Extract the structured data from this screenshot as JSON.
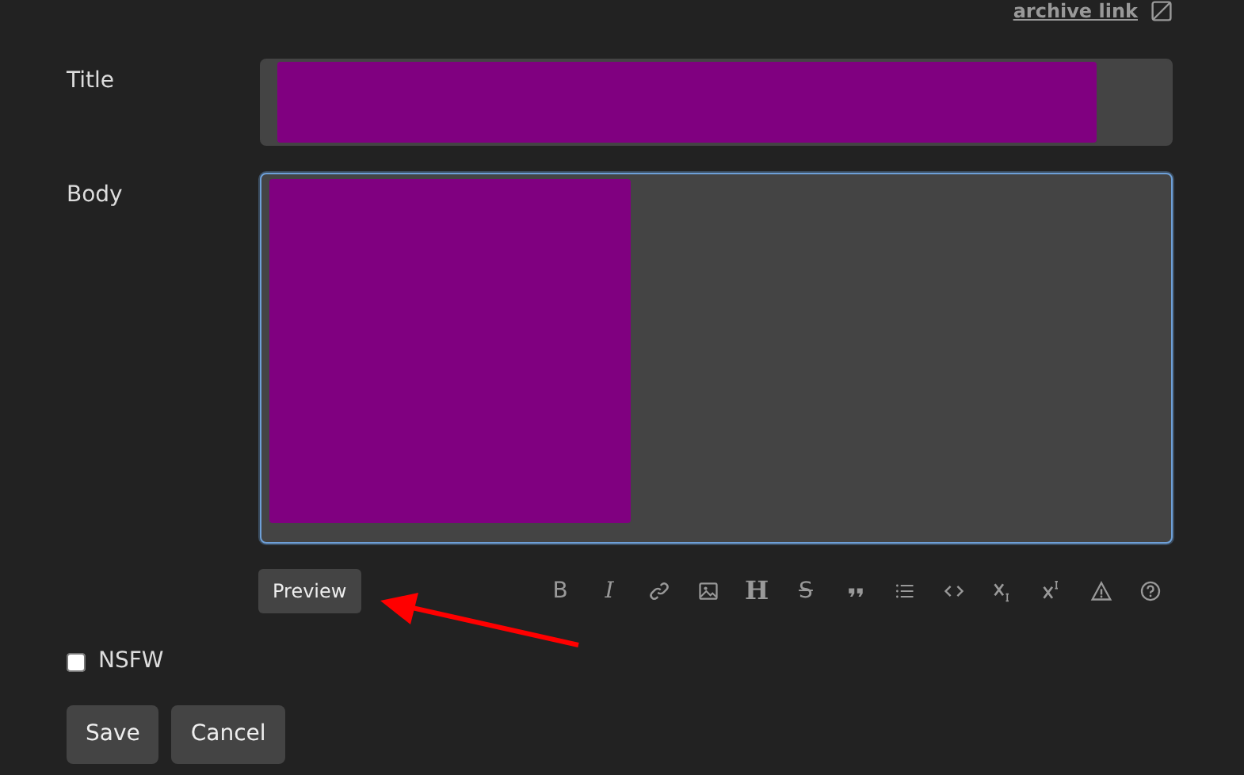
{
  "archive_link": {
    "label": "archive link"
  },
  "title_field": {
    "label": "Title",
    "redacted": true
  },
  "body_field": {
    "label": "Body",
    "redacted": true,
    "focused": true
  },
  "preview_button": "Preview",
  "toolbar": [
    {
      "kind": "glyph",
      "text": "B"
    },
    {
      "kind": "glyph",
      "text": "I"
    },
    {
      "kind": "icon"
    },
    {
      "kind": "icon"
    },
    {
      "kind": "glyph",
      "text": "H"
    },
    {
      "kind": "glyph",
      "text": "S"
    },
    {
      "kind": "icon"
    },
    {
      "kind": "icon"
    },
    {
      "kind": "icon"
    },
    {
      "kind": "icon"
    },
    {
      "kind": "icon"
    },
    {
      "kind": "icon"
    },
    {
      "kind": "icon"
    }
  ],
  "nsfw": {
    "label": "NSFW",
    "checked": false
  },
  "buttons": [
    "Save",
    "Cancel"
  ],
  "annotation": {
    "kind": "arrow",
    "color": "#ff0000"
  }
}
